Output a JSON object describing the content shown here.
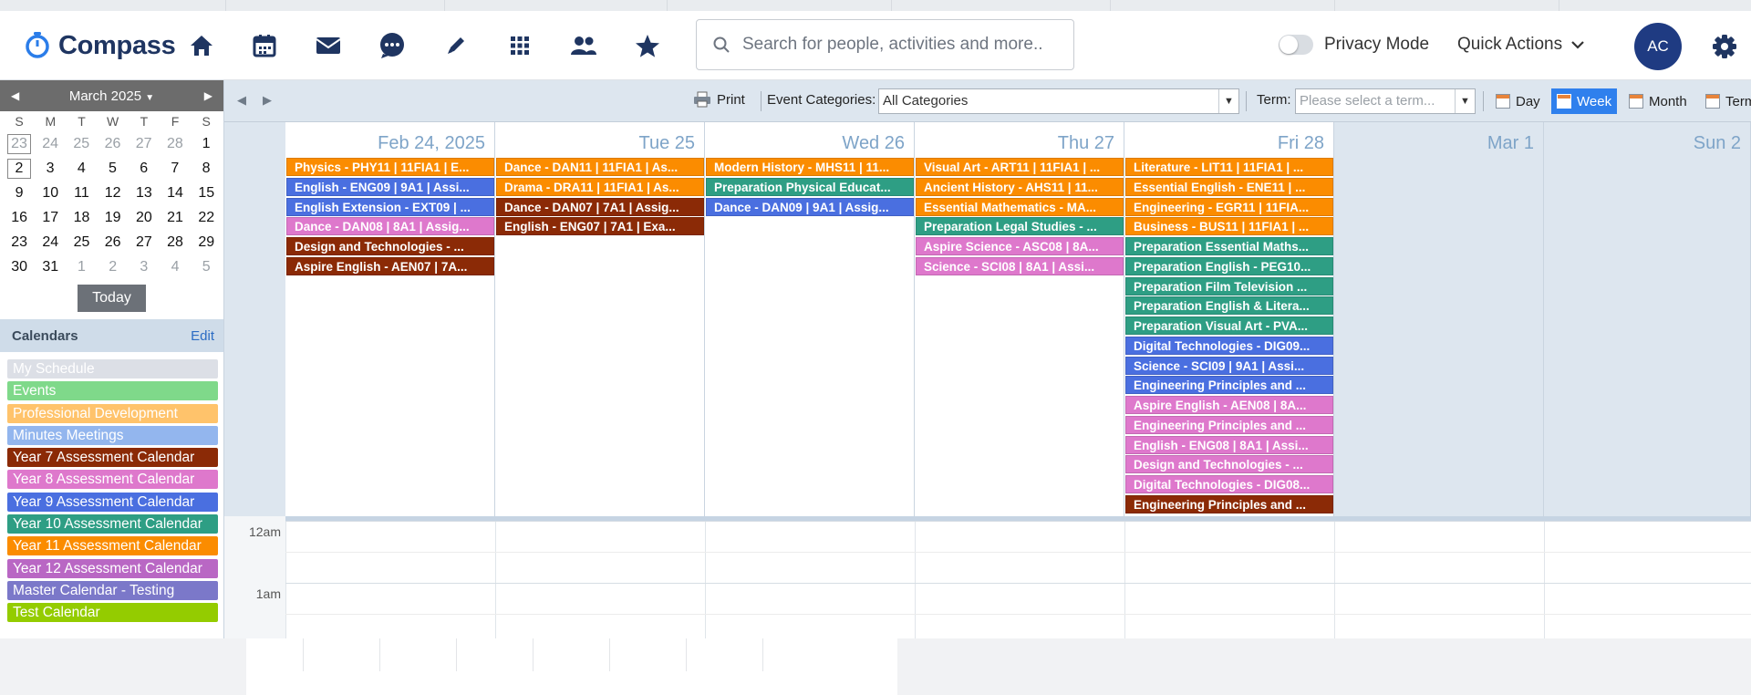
{
  "header": {
    "logo_text": "Compass",
    "search_placeholder": "Search for people, activities and more...",
    "privacy_label": "Privacy Mode",
    "quick_actions_label": "Quick Actions",
    "avatar_initials": "AC",
    "nav_icons": [
      "home-icon",
      "calendar-icon",
      "mail-icon",
      "chat-icon",
      "pencil-icon",
      "grid-icon",
      "people-icon",
      "star-icon"
    ]
  },
  "mini_calendar": {
    "month_label": "March 2025",
    "weekdays": [
      "S",
      "M",
      "T",
      "W",
      "T",
      "F",
      "S"
    ],
    "weeks": [
      [
        "23",
        "24",
        "25",
        "26",
        "27",
        "28",
        "1"
      ],
      [
        "2",
        "3",
        "4",
        "5",
        "6",
        "7",
        "8"
      ],
      [
        "9",
        "10",
        "11",
        "12",
        "13",
        "14",
        "15"
      ],
      [
        "16",
        "17",
        "18",
        "19",
        "20",
        "21",
        "22"
      ],
      [
        "23",
        "24",
        "25",
        "26",
        "27",
        "28",
        "29"
      ],
      [
        "30",
        "31",
        "1",
        "2",
        "3",
        "4",
        "5"
      ]
    ],
    "today_label": "Today"
  },
  "calendars": {
    "title": "Calendars",
    "edit_label": "Edit",
    "items": [
      {
        "label": "My Schedule",
        "color": "#dcdfe6"
      },
      {
        "label": "Events",
        "color": "#7fd98a"
      },
      {
        "label": "Professional Development",
        "color": "#ffc36b"
      },
      {
        "label": "Minutes Meetings",
        "color": "#93b6ee"
      },
      {
        "label": "Year 7 Assessment Calendar",
        "color": "#8b2a06"
      },
      {
        "label": "Year 8 Assessment Calendar",
        "color": "#de78cc"
      },
      {
        "label": "Year 9 Assessment Calendar",
        "color": "#4a6fe0"
      },
      {
        "label": "Year 10 Assessment Calendar",
        "color": "#2e9e84"
      },
      {
        "label": "Year 11 Assessment Calendar",
        "color": "#fb8c00"
      },
      {
        "label": "Year 12 Assessment Calendar",
        "color": "#b967c4"
      },
      {
        "label": "Master Calendar - Testing",
        "color": "#7b78c9"
      },
      {
        "label": "Test Calendar",
        "color": "#94cc00"
      }
    ]
  },
  "toolbar": {
    "print_label": "Print",
    "event_categories_label": "Event Categories:",
    "event_categories_value": "All Categories",
    "term_label": "Term:",
    "term_placeholder": "Please select a term...",
    "views": [
      "Day",
      "Week",
      "Month",
      "Term"
    ],
    "active_view": "Week"
  },
  "week": {
    "days": [
      {
        "label": "Feb 24, 2025",
        "events": [
          {
            "text": "Physics - PHY11 | 11FIA1 | E...",
            "color": "#fb8c00"
          },
          {
            "text": "English - ENG09 | 9A1 | Assi...",
            "color": "#4a6fe0"
          },
          {
            "text": "English Extension - EXT09 | ...",
            "color": "#4a6fe0"
          },
          {
            "text": "Dance - DAN08 | 8A1 | Assig...",
            "color": "#de78cc"
          },
          {
            "text": "Design and Technologies - ...",
            "color": "#8b2a06"
          },
          {
            "text": "Aspire English - AEN07 | 7A...",
            "color": "#8b2a06"
          }
        ]
      },
      {
        "label": "Tue 25",
        "events": [
          {
            "text": "Dance - DAN11 | 11FIA1 | As...",
            "color": "#fb8c00"
          },
          {
            "text": "Drama - DRA11 | 11FIA1 | As...",
            "color": "#fb8c00"
          },
          {
            "text": "Dance - DAN07 | 7A1 | Assig...",
            "color": "#8b2a06"
          },
          {
            "text": "English - ENG07 | 7A1 | Exa...",
            "color": "#8b2a06"
          }
        ]
      },
      {
        "label": "Wed 26",
        "events": [
          {
            "text": "Modern History - MHS11 | 11...",
            "color": "#fb8c00"
          },
          {
            "text": "Preparation Physical Educat...",
            "color": "#2e9e84"
          },
          {
            "text": "Dance - DAN09 | 9A1 | Assig...",
            "color": "#4a6fe0"
          }
        ]
      },
      {
        "label": "Thu 27",
        "events": [
          {
            "text": "Visual Art - ART11 | 11FIA1 | ...",
            "color": "#fb8c00"
          },
          {
            "text": "Ancient History - AHS11 | 11...",
            "color": "#fb8c00"
          },
          {
            "text": "Essential Mathematics - MA...",
            "color": "#fb8c00"
          },
          {
            "text": "Preparation Legal Studies - ...",
            "color": "#2e9e84"
          },
          {
            "text": "Aspire Science - ASC08 | 8A...",
            "color": "#de78cc"
          },
          {
            "text": "Science - SCI08 | 8A1 | Assi...",
            "color": "#de78cc"
          }
        ]
      },
      {
        "label": "Fri 28",
        "events": [
          {
            "text": "Literature - LIT11 | 11FIA1 | ...",
            "color": "#fb8c00"
          },
          {
            "text": "Essential English - ENE11 | ...",
            "color": "#fb8c00"
          },
          {
            "text": "Engineering - EGR11 | 11FIA...",
            "color": "#fb8c00"
          },
          {
            "text": "Business - BUS11 | 11FIA1 | ...",
            "color": "#fb8c00"
          },
          {
            "text": "Preparation Essential Maths...",
            "color": "#2e9e84"
          },
          {
            "text": "Preparation English - PEG10...",
            "color": "#2e9e84"
          },
          {
            "text": "Preparation Film Television ...",
            "color": "#2e9e84"
          },
          {
            "text": "Preparation English & Litera...",
            "color": "#2e9e84"
          },
          {
            "text": "Preparation Visual Art - PVA...",
            "color": "#2e9e84"
          },
          {
            "text": "Digital Technologies - DIG09...",
            "color": "#4a6fe0"
          },
          {
            "text": "Science - SCI09 | 9A1 | Assi...",
            "color": "#4a6fe0"
          },
          {
            "text": "Engineering Principles and ...",
            "color": "#4a6fe0"
          },
          {
            "text": "Aspire English - AEN08 | 8A...",
            "color": "#de78cc"
          },
          {
            "text": "Engineering Principles and ...",
            "color": "#de78cc"
          },
          {
            "text": "English - ENG08 | 8A1 | Assi...",
            "color": "#de78cc"
          },
          {
            "text": "Design and Technologies - ...",
            "color": "#de78cc"
          },
          {
            "text": "Digital Technologies - DIG08...",
            "color": "#de78cc"
          },
          {
            "text": "Engineering Principles and ...",
            "color": "#8b2a06"
          }
        ]
      },
      {
        "label": "Mar 1",
        "events": []
      },
      {
        "label": "Sun 2",
        "events": []
      }
    ],
    "time_labels": [
      "12am",
      "1am"
    ]
  }
}
